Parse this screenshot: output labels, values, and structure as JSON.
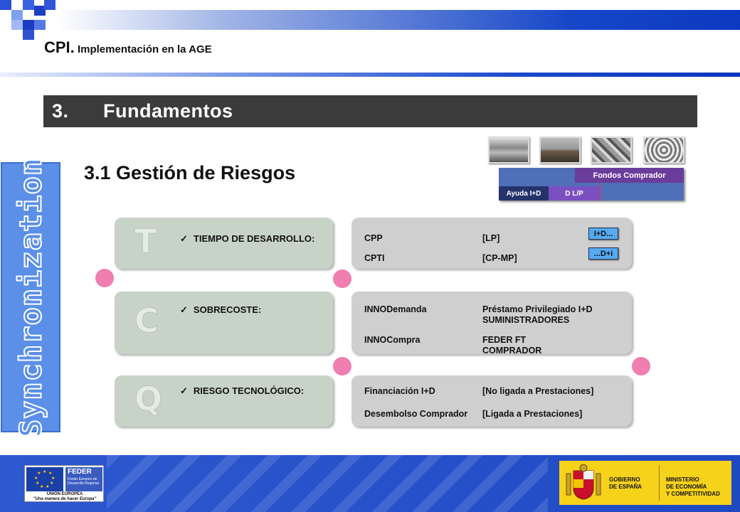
{
  "header": {
    "title_big": "CPI.",
    "title_small": "Implementación en la AGE"
  },
  "section": {
    "number": "3.",
    "title": "Fundamentos"
  },
  "subtitle": "3.1  Gestión de Riesgos",
  "sidebar": {
    "label": "Synchronization"
  },
  "funding_chart": {
    "top_label": "Fondos Comprador",
    "left_label": "Ayuda I+D",
    "mid_label": "D L/P"
  },
  "rows": [
    {
      "letter": "T",
      "check": "TIEMPO DE DESARROLLO:",
      "items": [
        {
          "name": "CPP",
          "value": "[LP]"
        },
        {
          "name": "CPTI",
          "value": "[CP-MP]"
        }
      ],
      "tags": [
        "I+D...",
        "...D+i"
      ]
    },
    {
      "letter": "C",
      "check": "SOBRECOSTE:",
      "items": [
        {
          "name": "INNODemanda",
          "value": "Préstamo Privilegiado I+D",
          "value2": "SUMINISTRADORES"
        },
        {
          "name": "INNOCompra",
          "value": "FEDER FT",
          "value2": "COMPRADOR"
        }
      ]
    },
    {
      "letter": "Q",
      "check": "RIESGO TECNOLÓGICO:",
      "items": [
        {
          "name": "Financiación I+D",
          "value": "[No ligada a Prestaciones]"
        },
        {
          "name": "Desembolso Comprador",
          "value": "[Ligada a Prestaciones]"
        }
      ]
    }
  ],
  "footer": {
    "eu_feder": "FEDER",
    "eu_feder_sub": "Fondo Europeo de Desarrollo Regional",
    "eu_union": "UNIÓN EUROPEA",
    "eu_motto": "\"Una manera de hacer Europa\"",
    "gob_1": "GOBIERNO",
    "gob_2": "DE ESPAÑA",
    "min_1": "MINISTERIO",
    "min_2": "DE ECONOMÍA",
    "min_3": "Y COMPETITIVIDAD"
  },
  "colors": {
    "accent_blue": "#1747c8",
    "section_bar": "#3b3b3b",
    "card_left": "#c8d3c8",
    "card_right": "#cfcfcf",
    "dot_pink": "#f07eb0",
    "tag_blue": "#55aaf0",
    "fund_purple": "#6a3d9a",
    "gob_yellow": "#f7d21b"
  }
}
